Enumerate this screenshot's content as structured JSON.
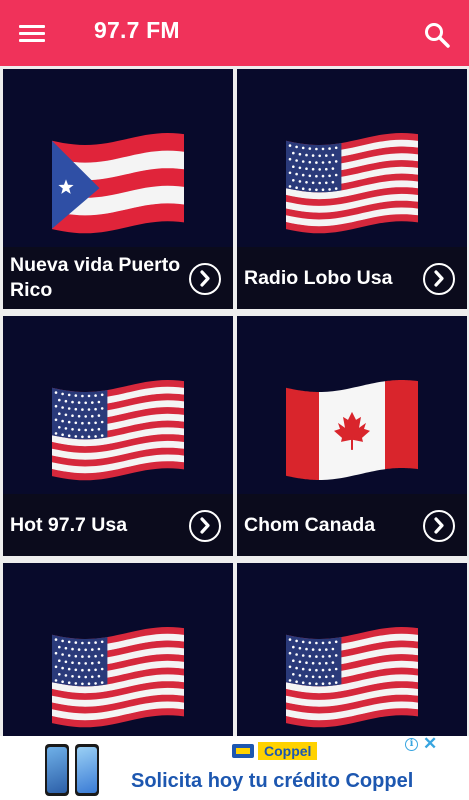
{
  "app": {
    "title": "97.7 FM",
    "accent": "#f0325a"
  },
  "toolbar": {
    "menu_icon": "menu-icon",
    "search_icon": "search-icon"
  },
  "stations": [
    {
      "name": "Nueva vida Puerto Rico",
      "flag": "puerto-rico"
    },
    {
      "name": "Radio Lobo Usa",
      "flag": "usa"
    },
    {
      "name": "Hot 97.7 Usa",
      "flag": "usa"
    },
    {
      "name": "Chom Canada",
      "flag": "canada"
    },
    {
      "name": "",
      "flag": "usa"
    },
    {
      "name": "",
      "flag": "usa"
    }
  ],
  "ad": {
    "brand": "Coppel",
    "headline": "Solicita hoy tu crédito Coppel",
    "brand_color": "#1d57b0",
    "brand_yellow": "#ffd200",
    "info_glyph": "i",
    "close_glyph": "✕"
  }
}
